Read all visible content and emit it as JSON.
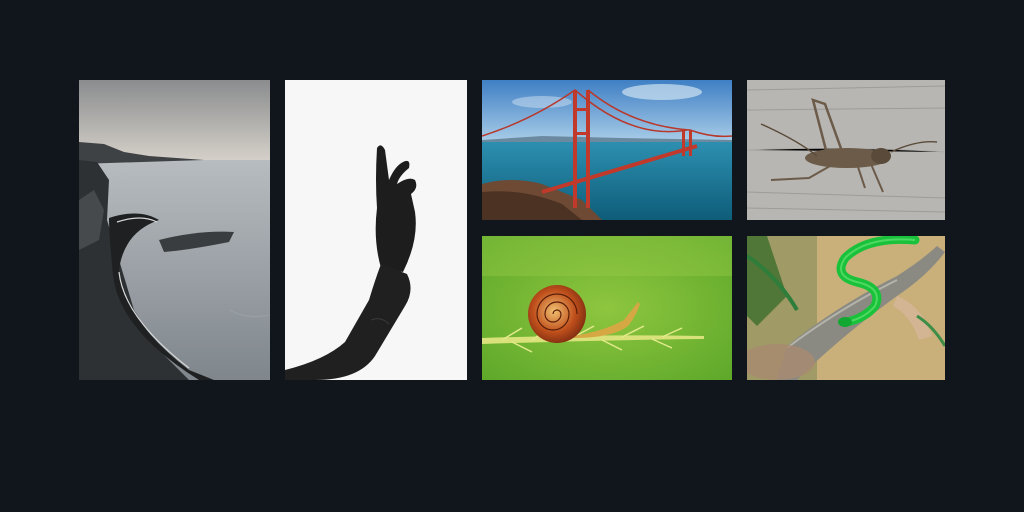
{
  "gallery": {
    "background_color": "#11161c",
    "tiles": [
      {
        "subject": "coastal-road-photo"
      },
      {
        "subject": "hand-silhouette-photo"
      },
      {
        "subject": "suspension-bridge-photo"
      },
      {
        "subject": "cricket-photo"
      },
      {
        "subject": "snail-photo"
      },
      {
        "subject": "green-snake-photo"
      }
    ]
  }
}
